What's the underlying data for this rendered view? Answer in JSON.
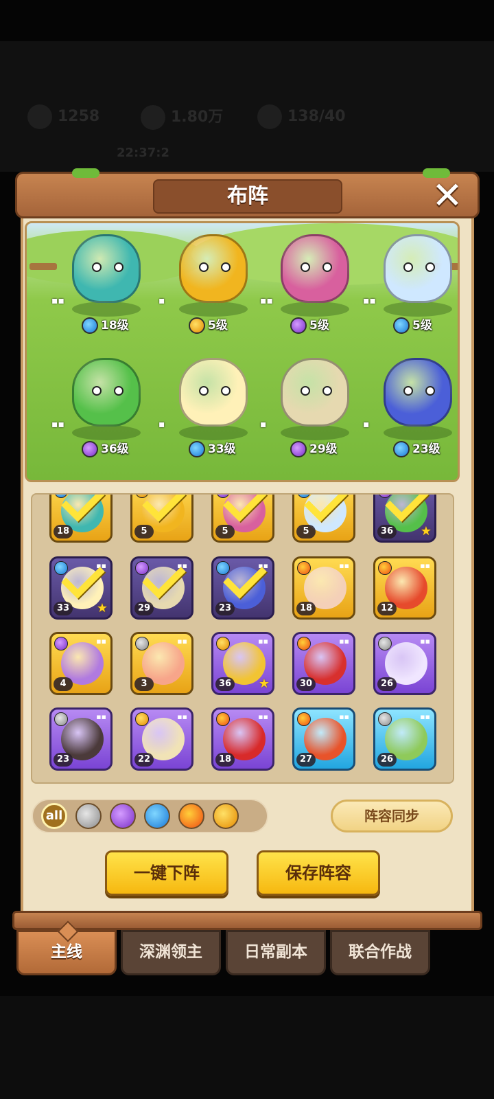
{
  "background": {
    "resources": [
      "1258",
      "1.80万",
      "138/40"
    ],
    "status_text": "22:37:2"
  },
  "panel": {
    "title": "布阵",
    "close_label": "✕"
  },
  "lineup": [
    {
      "level": "18级",
      "element": "water",
      "pips": "▪▪",
      "color": "#3fb7b0"
    },
    {
      "level": "5级",
      "element": "thunder",
      "pips": "▪",
      "color": "#f1b51f"
    },
    {
      "level": "5级",
      "element": "poison",
      "pips": "▪▪",
      "color": "#d8609e"
    },
    {
      "level": "5级",
      "element": "water",
      "pips": "▪▪",
      "color": "#cfe8ff"
    },
    {
      "level": "36级",
      "element": "poison",
      "pips": "▪▪",
      "color": "#55c04a"
    },
    {
      "level": "33级",
      "element": "water",
      "pips": "▪",
      "color": "#fff1b8"
    },
    {
      "level": "29级",
      "element": "poison",
      "pips": "▪",
      "color": "#e6d9b0"
    },
    {
      "level": "23级",
      "element": "water",
      "pips": "▪",
      "color": "#4b5fd8"
    }
  ],
  "roster": [
    {
      "level": "18",
      "frame": "gold",
      "checked": true,
      "element": "water",
      "color": "#3fb7b0"
    },
    {
      "level": "5",
      "frame": "gold",
      "checked": true,
      "element": "thunder",
      "color": "#f1b51f"
    },
    {
      "level": "5",
      "frame": "gold",
      "checked": true,
      "element": "poison",
      "color": "#d8609e"
    },
    {
      "level": "5",
      "frame": "gold",
      "checked": true,
      "element": "water",
      "color": "#cfe8ff"
    },
    {
      "level": "36",
      "frame": "dark",
      "checked": true,
      "element": "poison",
      "color": "#55c04a",
      "star": true
    },
    {
      "level": "33",
      "frame": "dark",
      "checked": true,
      "element": "water",
      "color": "#fff1b8",
      "star": true
    },
    {
      "level": "29",
      "frame": "dark",
      "checked": true,
      "element": "poison",
      "color": "#e6d9b0"
    },
    {
      "level": "23",
      "frame": "dark",
      "checked": true,
      "element": "water",
      "color": "#4b5fd8"
    },
    {
      "level": "18",
      "frame": "gold",
      "checked": false,
      "element": "fire",
      "color": "#f4d0b8"
    },
    {
      "level": "12",
      "frame": "gold",
      "checked": false,
      "element": "fire",
      "color": "#e64a2c"
    },
    {
      "level": "4",
      "frame": "gold",
      "checked": false,
      "element": "poison",
      "color": "#b07ae0"
    },
    {
      "level": "3",
      "frame": "gold",
      "checked": false,
      "element": "blade",
      "color": "#f7a58a"
    },
    {
      "level": "36",
      "frame": "purple",
      "checked": false,
      "element": "thunder",
      "color": "#f2c433",
      "star": true
    },
    {
      "level": "30",
      "frame": "purple",
      "checked": false,
      "element": "fire",
      "color": "#d8302e"
    },
    {
      "level": "26",
      "frame": "purple",
      "checked": false,
      "element": "blade",
      "color": "#f0e6ff"
    },
    {
      "level": "23",
      "frame": "purple",
      "checked": false,
      "element": "blade",
      "color": "#4b3a3a"
    },
    {
      "level": "22",
      "frame": "purple",
      "checked": false,
      "element": "thunder",
      "color": "#f1e3b6"
    },
    {
      "level": "18",
      "frame": "purple",
      "checked": false,
      "element": "fire",
      "color": "#d82a2a"
    },
    {
      "level": "27",
      "frame": "blue",
      "checked": false,
      "element": "fire",
      "color": "#e8532a"
    },
    {
      "level": "26",
      "frame": "blue",
      "checked": false,
      "element": "blade",
      "color": "#8fca5a"
    }
  ],
  "filters": [
    {
      "id": "all",
      "label": "all"
    },
    {
      "id": "blade",
      "label": ""
    },
    {
      "id": "poison",
      "label": ""
    },
    {
      "id": "water",
      "label": ""
    },
    {
      "id": "fire",
      "label": ""
    },
    {
      "id": "thunder",
      "label": ""
    }
  ],
  "buttons": {
    "sync": "阵容同步",
    "remove_all": "一键下阵",
    "save": "保存阵容"
  },
  "tabs": [
    {
      "label": "主线",
      "active": true
    },
    {
      "label": "深渊领主",
      "active": false
    },
    {
      "label": "日常副本",
      "active": false
    },
    {
      "label": "联合作战",
      "active": false
    }
  ]
}
